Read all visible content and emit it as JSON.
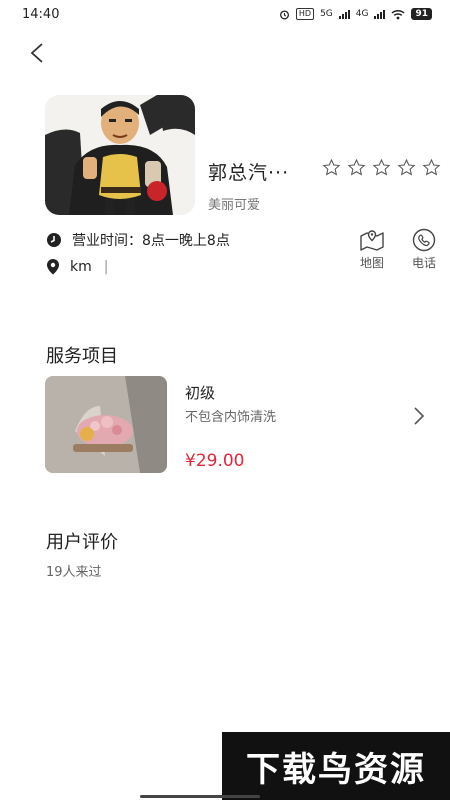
{
  "status_bar": {
    "time": "14:40",
    "hd_label": "HD",
    "net1": "5G",
    "net2": "4G",
    "battery": "91"
  },
  "shop": {
    "name": "郭总汽···",
    "tag": "美丽可爱",
    "rating_stars_filled": 0,
    "rating_stars_total": 5,
    "hours": "营业时间：8点一晚上8点",
    "distance": "km",
    "distance_sep": "|"
  },
  "actions": {
    "map_label": "地图",
    "phone_label": "电话"
  },
  "services": {
    "title": "服务项目",
    "items": [
      {
        "name": "初级",
        "desc": "不包含内饰清洗",
        "price": "¥29.00"
      }
    ]
  },
  "reviews": {
    "title": "用户评价",
    "count_text": "19人来过"
  },
  "watermark": {
    "text": "下载鸟资源"
  },
  "colors": {
    "price": "#e0283a",
    "text": "#222222",
    "muted": "#666666"
  }
}
